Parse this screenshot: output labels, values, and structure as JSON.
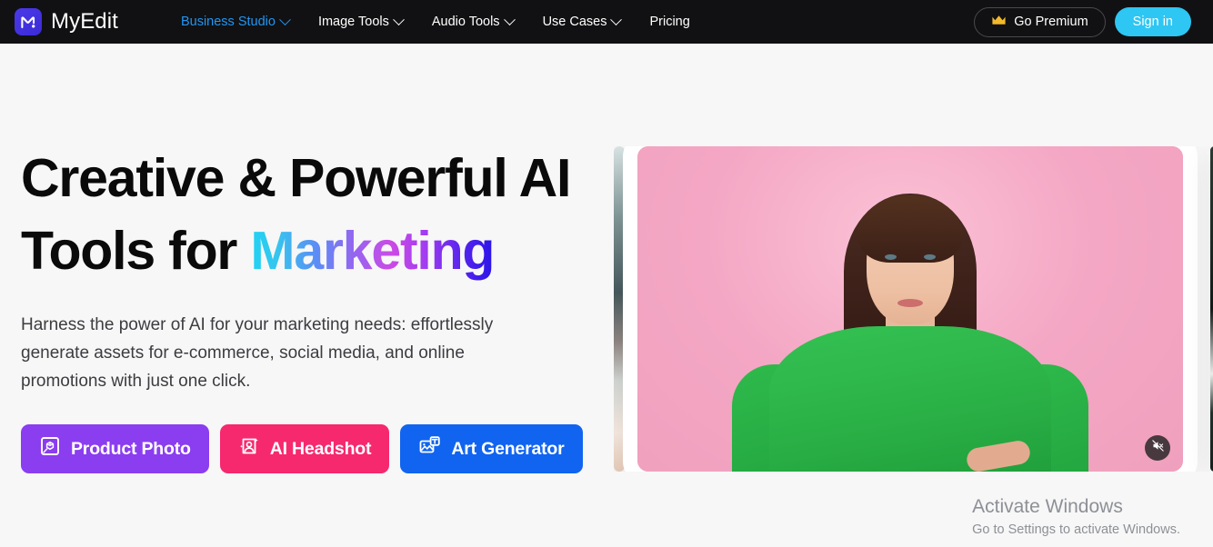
{
  "header": {
    "brand": {
      "name": "MyEdit",
      "logo_icon": "myedit-logo-m-mark",
      "logo_color": "#4033de"
    },
    "nav": [
      {
        "label": "Business Studio",
        "has_chevron": true,
        "active": true
      },
      {
        "label": "Image Tools",
        "has_chevron": true,
        "active": false
      },
      {
        "label": "Audio Tools",
        "has_chevron": true,
        "active": false
      },
      {
        "label": "Use Cases",
        "has_chevron": true,
        "active": false
      },
      {
        "label": "Pricing",
        "has_chevron": false,
        "active": false
      }
    ],
    "premium_button": {
      "label": "Go Premium",
      "icon": "crown-icon",
      "icon_color": "#f2b92c"
    },
    "signin_button": {
      "label": "Sign in",
      "color": "#2ec6f2"
    },
    "background_color": "#111113",
    "active_nav_color": "#2196f3"
  },
  "hero": {
    "title_line1": "Creative & Powerful AI",
    "title_line2_plain": "Tools for ",
    "title_line2_gradient": "Marketing",
    "gradient_colors": [
      "#1fd3f3",
      "#5b8ef5",
      "#9a62f0",
      "#cc4ae6",
      "#5b25ee",
      "#2a15e8"
    ],
    "subtitle": "Harness the power of AI for your marketing needs: effortlessly generate assets for e-commerce, social media, and online promotions with just one click.",
    "cta_buttons": [
      {
        "label": "Product Photo",
        "icon": "product-photo-icon",
        "color": "#8b3df0"
      },
      {
        "label": "AI Headshot",
        "icon": "ai-headshot-icon",
        "color": "#f6286e"
      },
      {
        "label": "Art Generator",
        "icon": "art-generator-icon",
        "color": "#1064f0"
      }
    ]
  },
  "carousel": {
    "current_slide_alt": "Woman with brown hair in green top on pink background",
    "mute_button": {
      "icon": "mute-speaker-icon",
      "state": "muted"
    },
    "prev_slide_alt": "previous slide sliver",
    "next_slide_alt": "next slide sliver"
  },
  "watermark": {
    "title": "Activate Windows",
    "subtitle": "Go to Settings to activate Windows."
  }
}
